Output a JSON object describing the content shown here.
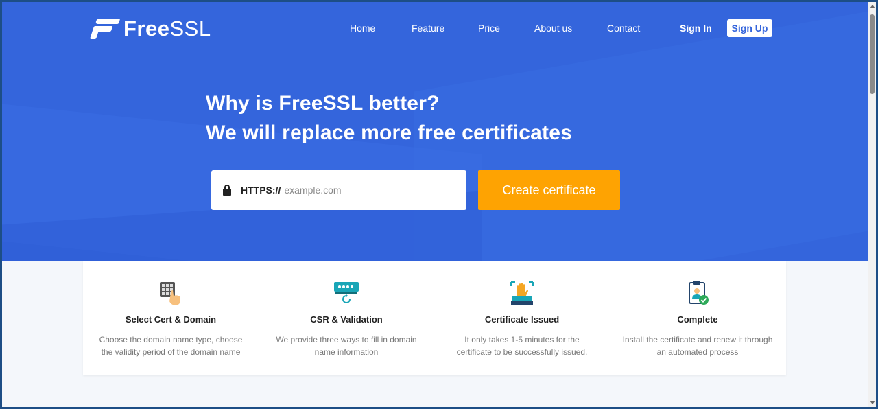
{
  "brand": {
    "name_bold": "Free",
    "name_thin": "SSL"
  },
  "nav": {
    "items": [
      {
        "label": "Home"
      },
      {
        "label": "Feature"
      },
      {
        "label": "Price"
      },
      {
        "label": "About us"
      },
      {
        "label": "Contact"
      }
    ],
    "signin_label": "Sign In",
    "signup_label": "Sign Up"
  },
  "hero": {
    "line1": "Why is FreeSSL better?",
    "line2": "We will replace more free certificates",
    "scheme_label": "HTTPS://",
    "domain_placeholder": "example.com",
    "domain_value": "",
    "create_label": "Create certificate"
  },
  "steps": [
    {
      "icon": "keypad-hand-icon",
      "title": "Select Cert & Domain",
      "desc": "Choose the domain name type, choose the validity period of the domain name"
    },
    {
      "icon": "password-refresh-icon",
      "title": "CSR & Validation",
      "desc": "We provide three ways to fill in domain name information"
    },
    {
      "icon": "hand-scan-icon",
      "title": "Certificate Issued",
      "desc": "It only takes 1-5 minutes for the certificate to be successfully issued."
    },
    {
      "icon": "clipboard-check-user-icon",
      "title": "Complete",
      "desc": "Install the certificate and renew it through an automated process"
    }
  ],
  "colors": {
    "hero_bg": "#3465dc",
    "accent_orange": "#fea302",
    "white": "#ffffff"
  }
}
